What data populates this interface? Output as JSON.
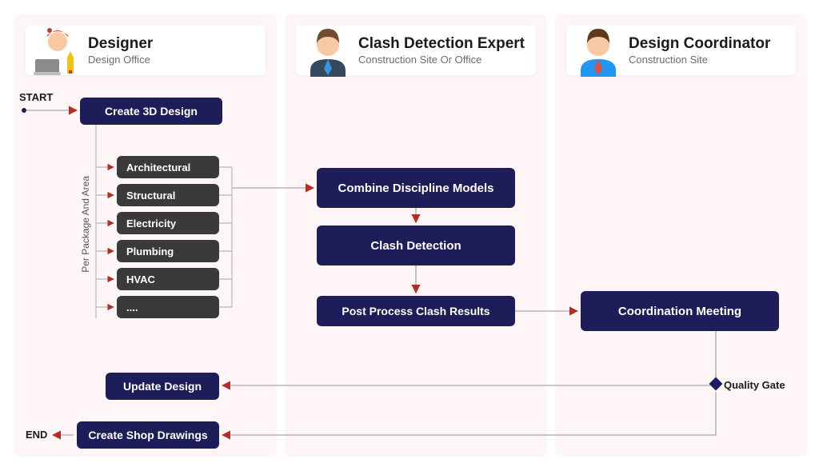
{
  "lanes": [
    {
      "title": "Designer",
      "sub": "Design Office"
    },
    {
      "title": "Clash Detection Expert",
      "sub": "Construction Site Or Office"
    },
    {
      "title": "Design Coordinator",
      "sub": "Construction Site"
    }
  ],
  "labels": {
    "start": "START",
    "end": "END",
    "per_package": "Per Package And Area",
    "quality_gate": "Quality Gate"
  },
  "steps": {
    "create_3d": "Create 3D Design",
    "update_design": "Update Design",
    "shop_drawings": "Create Shop Drawings",
    "combine": "Combine Discipline Models",
    "clash": "Clash Detection",
    "postprocess": "Post Process Clash Results",
    "meeting": "Coordination Meeting"
  },
  "disciplines": [
    "Architectural",
    "Structural",
    "Electricity",
    "Plumbing",
    "HVAC",
    "...."
  ],
  "chart_data": {
    "type": "table",
    "description": "Swimlane process flow diagram with 3 roles",
    "roles": [
      {
        "name": "Designer",
        "location": "Design Office"
      },
      {
        "name": "Clash Detection Expert",
        "location": "Construction Site Or Office"
      },
      {
        "name": "Design Coordinator",
        "location": "Construction Site"
      }
    ],
    "nodes": [
      {
        "id": "start",
        "type": "terminator",
        "lane": 0,
        "label": "START"
      },
      {
        "id": "create_3d",
        "type": "process",
        "lane": 0,
        "label": "Create 3D Design"
      },
      {
        "id": "disciplines",
        "type": "subprocess-group",
        "lane": 0,
        "label": "Per Package And Area",
        "items": [
          "Architectural",
          "Structural",
          "Electricity",
          "Plumbing",
          "HVAC",
          "...."
        ]
      },
      {
        "id": "combine",
        "type": "process",
        "lane": 1,
        "label": "Combine Discipline Models"
      },
      {
        "id": "clash",
        "type": "process",
        "lane": 1,
        "label": "Clash Detection"
      },
      {
        "id": "postprocess",
        "type": "process",
        "lane": 1,
        "label": "Post Process Clash Results"
      },
      {
        "id": "meeting",
        "type": "process",
        "lane": 2,
        "label": "Coordination Meeting"
      },
      {
        "id": "quality_gate",
        "type": "decision",
        "lane": 2,
        "label": "Quality Gate"
      },
      {
        "id": "update_design",
        "type": "process",
        "lane": 0,
        "label": "Update Design"
      },
      {
        "id": "shop_drawings",
        "type": "process",
        "lane": 0,
        "label": "Create Shop Drawings"
      },
      {
        "id": "end",
        "type": "terminator",
        "lane": 0,
        "label": "END"
      }
    ],
    "edges": [
      {
        "from": "start",
        "to": "create_3d"
      },
      {
        "from": "create_3d",
        "to": "disciplines"
      },
      {
        "from": "disciplines",
        "to": "combine"
      },
      {
        "from": "combine",
        "to": "clash"
      },
      {
        "from": "clash",
        "to": "postprocess"
      },
      {
        "from": "postprocess",
        "to": "meeting"
      },
      {
        "from": "meeting",
        "to": "quality_gate"
      },
      {
        "from": "quality_gate",
        "to": "update_design"
      },
      {
        "from": "quality_gate",
        "to": "shop_drawings"
      },
      {
        "from": "update_design",
        "to": "combine",
        "note": "loop"
      },
      {
        "from": "shop_drawings",
        "to": "end"
      }
    ]
  }
}
